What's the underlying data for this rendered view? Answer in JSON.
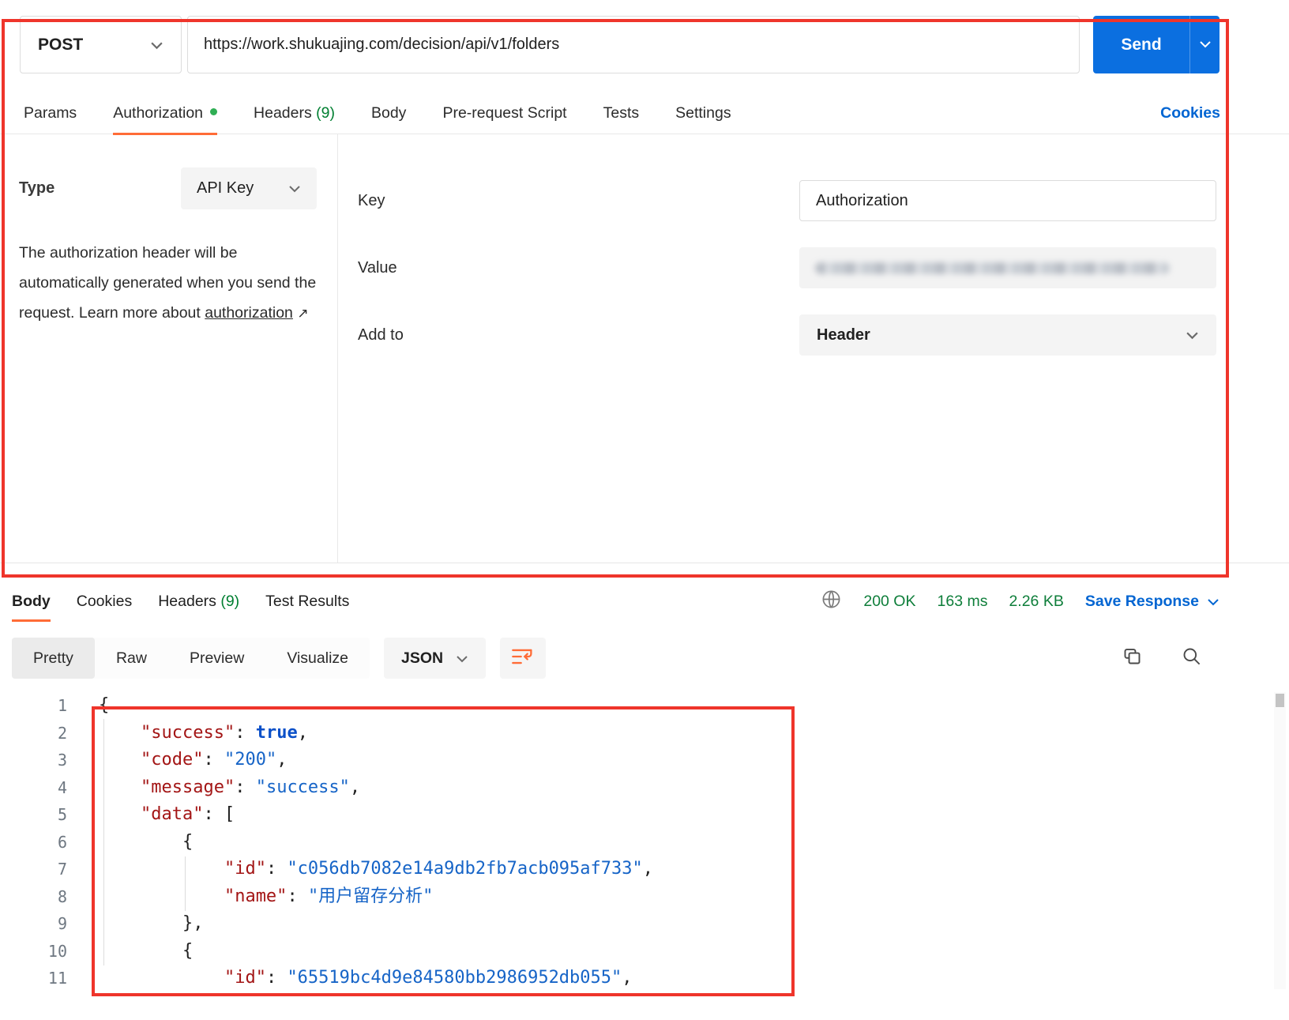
{
  "request": {
    "method": "POST",
    "url": "https://work.shukuajing.com/decision/api/v1/folders",
    "send_label": "Send"
  },
  "request_tabs": {
    "items": [
      {
        "name": "params",
        "label": "Params"
      },
      {
        "name": "authorization",
        "label": "Authorization",
        "active": true,
        "dot": true
      },
      {
        "name": "headers",
        "label": "Headers",
        "count": "(9)"
      },
      {
        "name": "body",
        "label": "Body"
      },
      {
        "name": "pre-request-script",
        "label": "Pre-request Script"
      },
      {
        "name": "tests",
        "label": "Tests"
      },
      {
        "name": "settings",
        "label": "Settings"
      }
    ],
    "cookies_label": "Cookies"
  },
  "auth": {
    "type_label": "Type",
    "type_value": "API Key",
    "description_before": "The authorization header will be automatically generated when you send the request. Learn more about ",
    "description_link": "authorization",
    "link_arrow": "↗",
    "key_label": "Key",
    "key_value": "Authorization",
    "value_label": "Value",
    "add_to_label": "Add to",
    "add_to_value": "Header"
  },
  "response": {
    "tabs": [
      {
        "name": "body",
        "label": "Body",
        "active": true
      },
      {
        "name": "cookies",
        "label": "Cookies"
      },
      {
        "name": "headers",
        "label": "Headers",
        "count": "(9)"
      },
      {
        "name": "test-results",
        "label": "Test Results"
      }
    ],
    "status": "200 OK",
    "time": "163 ms",
    "size": "2.26 KB",
    "save_label": "Save Response",
    "view_tabs": [
      {
        "name": "pretty",
        "label": "Pretty",
        "active": true
      },
      {
        "name": "raw",
        "label": "Raw"
      },
      {
        "name": "preview",
        "label": "Preview"
      },
      {
        "name": "visualize",
        "label": "Visualize"
      }
    ],
    "format": "JSON"
  },
  "code": {
    "lines": [
      {
        "n": 1,
        "tokens": [
          [
            "p",
            "{"
          ]
        ]
      },
      {
        "n": 2,
        "tokens": [
          [
            "w",
            "    "
          ],
          [
            "k",
            "\"success\""
          ],
          [
            "p",
            ": "
          ],
          [
            "b",
            "true"
          ],
          [
            "p",
            ","
          ]
        ]
      },
      {
        "n": 3,
        "tokens": [
          [
            "w",
            "    "
          ],
          [
            "k",
            "\"code\""
          ],
          [
            "p",
            ": "
          ],
          [
            "s",
            "\"200\""
          ],
          [
            "p",
            ","
          ]
        ]
      },
      {
        "n": 4,
        "tokens": [
          [
            "w",
            "    "
          ],
          [
            "k",
            "\"message\""
          ],
          [
            "p",
            ": "
          ],
          [
            "s",
            "\"success\""
          ],
          [
            "p",
            ","
          ]
        ]
      },
      {
        "n": 5,
        "tokens": [
          [
            "w",
            "    "
          ],
          [
            "k",
            "\"data\""
          ],
          [
            "p",
            ": ["
          ]
        ]
      },
      {
        "n": 6,
        "tokens": [
          [
            "w",
            "        "
          ],
          [
            "p",
            "{"
          ]
        ]
      },
      {
        "n": 7,
        "tokens": [
          [
            "w",
            "            "
          ],
          [
            "k",
            "\"id\""
          ],
          [
            "p",
            ": "
          ],
          [
            "s",
            "\"c056db7082e14a9db2fb7acb095af733\""
          ],
          [
            "p",
            ","
          ]
        ]
      },
      {
        "n": 8,
        "tokens": [
          [
            "w",
            "            "
          ],
          [
            "k",
            "\"name\""
          ],
          [
            "p",
            ": "
          ],
          [
            "s",
            "\"用户留存分析\""
          ]
        ]
      },
      {
        "n": 9,
        "tokens": [
          [
            "w",
            "        "
          ],
          [
            "p",
            "},"
          ]
        ]
      },
      {
        "n": 10,
        "tokens": [
          [
            "w",
            "        "
          ],
          [
            "p",
            "{"
          ]
        ]
      },
      {
        "n": 11,
        "tokens": [
          [
            "w",
            "            "
          ],
          [
            "k",
            "\"id\""
          ],
          [
            "p",
            ": "
          ],
          [
            "s",
            "\"65519bc4d9e84580bb2986952db055\""
          ],
          [
            "p",
            ","
          ]
        ]
      }
    ]
  }
}
